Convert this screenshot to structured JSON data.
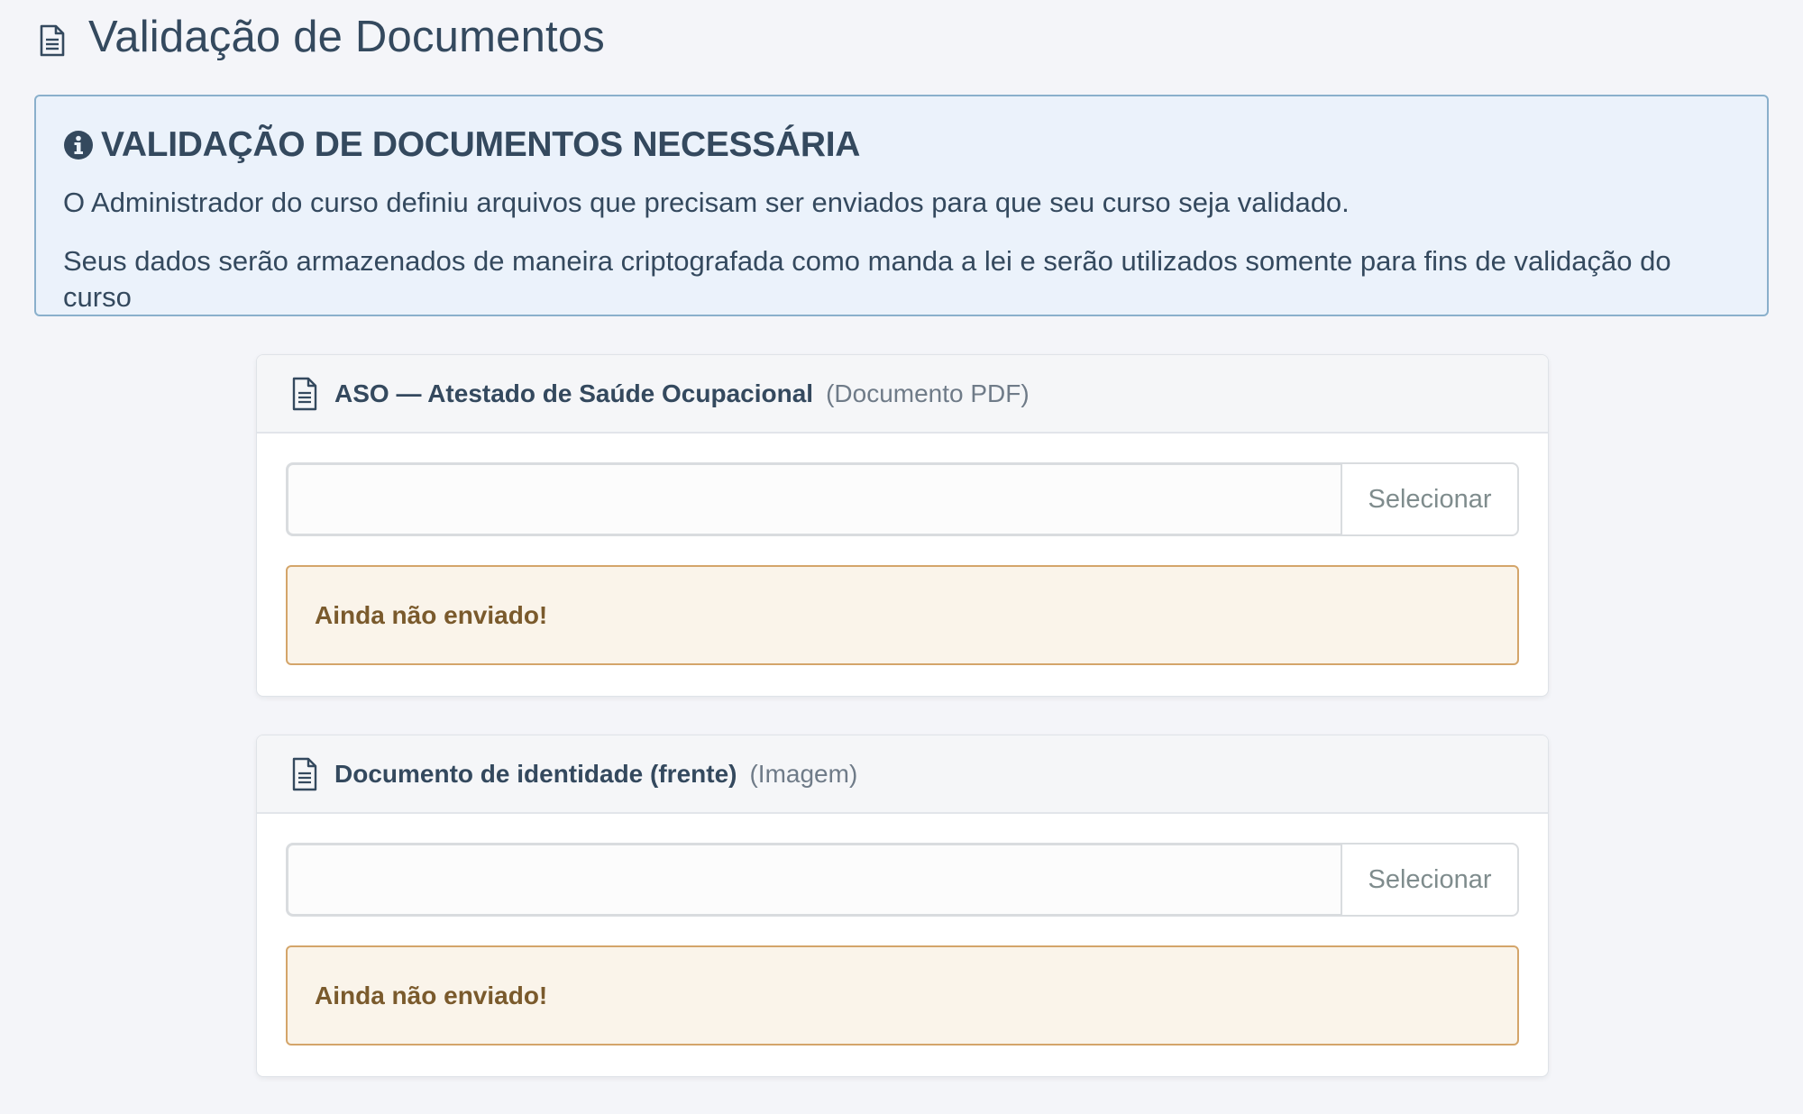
{
  "page": {
    "title": "Validação de Documentos",
    "title_icon": "document-icon"
  },
  "alert": {
    "icon": "info-circle-icon",
    "title": "VALIDAÇÃO DE DOCUMENTOS NECESSÁRIA",
    "line1": "O Administrador do curso definiu arquivos que precisam ser enviados para que seu curso seja validado.",
    "line2": "Seus dados serão armazenados de maneira criptografada como manda a lei e serão utilizados somente para fins de validação do curso"
  },
  "documents": [
    {
      "icon": "document-icon",
      "title": "ASO — Atestado de Saúde Ocupacional",
      "type": "(Documento PDF)",
      "file_value": "",
      "select_label": "Selecionar",
      "status": "Ainda não enviado!"
    },
    {
      "icon": "document-icon",
      "title": "Documento de identidade (frente)",
      "type": "(Imagem)",
      "file_value": "",
      "select_label": "Selecionar",
      "status": "Ainda não enviado!"
    }
  ],
  "colors": {
    "background": "#f4f5f9",
    "text": "#34495e",
    "info_bg": "#ebf2fb",
    "info_border": "#8ab0cc",
    "warning_bg": "#faf4ea",
    "warning_border": "#d4a56a",
    "warning_text": "#7a5a2c"
  }
}
